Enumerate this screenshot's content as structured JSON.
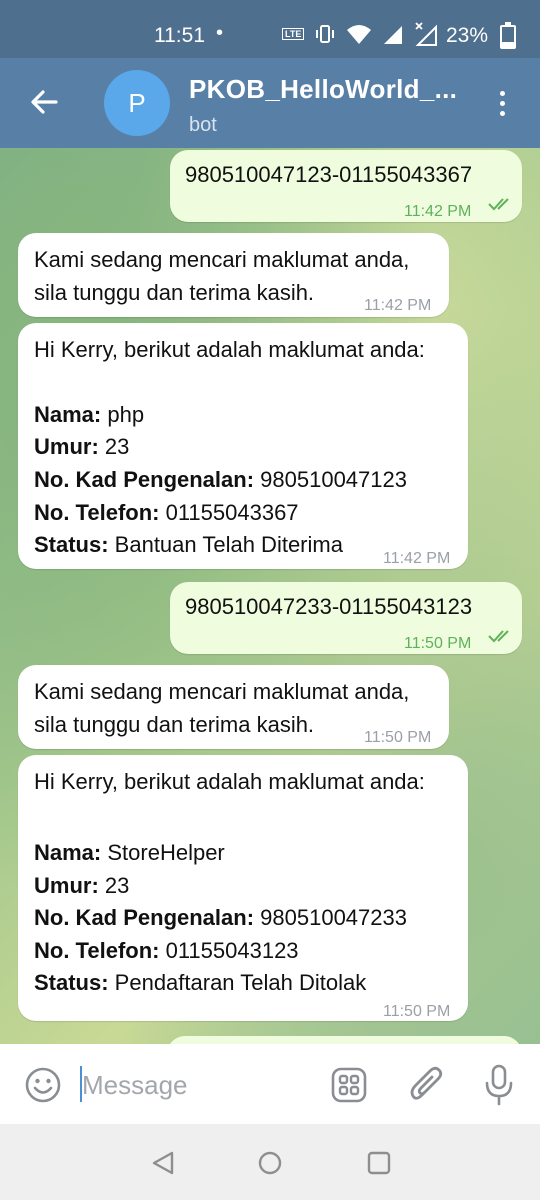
{
  "status_bar": {
    "time": "11:51",
    "dot": "•",
    "volte_label": "LTE",
    "battery_pct": "23%",
    "icons": [
      "volte-icon",
      "vibrate-icon",
      "wifi-icon",
      "signal-icon",
      "signal-x-icon",
      "battery-icon"
    ]
  },
  "header": {
    "avatar_letter": "P",
    "title": "PKOB_HelloWorld_...",
    "subtitle": "bot",
    "colors": {
      "header": "#5880a6",
      "avatar": "#5aa7ea"
    }
  },
  "messages": [
    {
      "dir": "out",
      "text": "980510047123-01155043367",
      "time": "11:42 PM",
      "read": true
    },
    {
      "dir": "in",
      "lines": [
        "Kami sedang mencari maklumat anda,",
        "sila tunggu dan terima kasih."
      ],
      "time": "11:42 PM"
    },
    {
      "dir": "in",
      "intro": "Hi Kerry, berikut adalah maklumat anda:",
      "fields": [
        {
          "label": "Nama:",
          "value": " php"
        },
        {
          "label": "Umur:",
          "value": " 23"
        },
        {
          "label": "No. Kad Pengenalan:",
          "value": " 980510047123"
        },
        {
          "label": "No. Telefon:",
          "value": " 01155043367"
        },
        {
          "label": "Status:",
          "value": " Bantuan Telah Diterima"
        }
      ],
      "time": "11:42 PM"
    },
    {
      "dir": "out",
      "text": "980510047233-01155043123",
      "time": "11:50 PM",
      "read": true
    },
    {
      "dir": "in",
      "lines": [
        "Kami sedang mencari maklumat anda,",
        "sila tunggu dan terima kasih."
      ],
      "time": "11:50 PM"
    },
    {
      "dir": "in",
      "intro": "Hi Kerry, berikut adalah maklumat anda:",
      "fields": [
        {
          "label": "Nama:",
          "value": " StoreHelper"
        },
        {
          "label": "Umur:",
          "value": " 23"
        },
        {
          "label": "No. Kad Pengenalan:",
          "value": " 980510047233"
        },
        {
          "label": "No. Telefon:",
          "value": " 01155043123"
        },
        {
          "label": "Status:",
          "value": " Pendaftaran Telah Ditolak"
        }
      ],
      "time": "11:50 PM"
    }
  ],
  "input": {
    "placeholder": "Message",
    "icons": [
      "emoji-icon",
      "sticker-icon",
      "attach-icon",
      "mic-icon"
    ]
  },
  "navbar": {
    "icons": [
      "back-nav-icon",
      "home-nav-icon",
      "recents-nav-icon"
    ]
  }
}
